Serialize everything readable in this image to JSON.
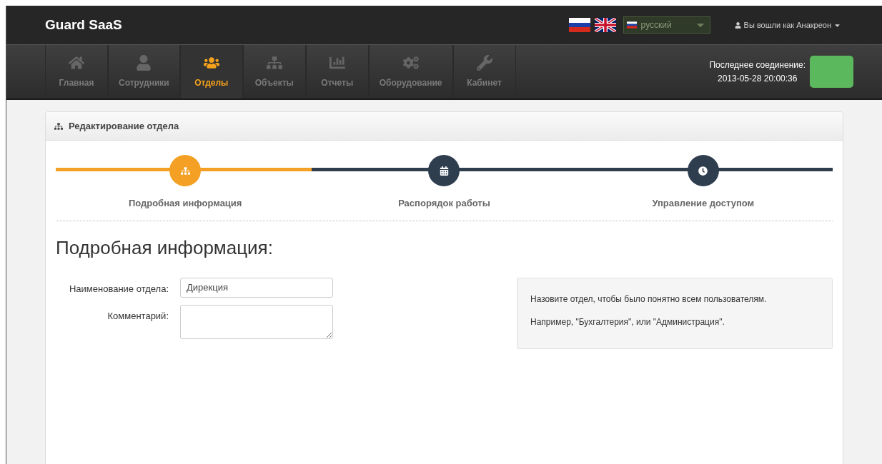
{
  "brand": "Guard SaaS",
  "language": {
    "value": "русский"
  },
  "user_menu": {
    "label": "Вы вошли как Анакреон"
  },
  "nav": [
    {
      "label": "Главная",
      "selected": false
    },
    {
      "label": "Сотрудники",
      "selected": false
    },
    {
      "label": "Отделы",
      "selected": true
    },
    {
      "label": "Объекты",
      "selected": false
    },
    {
      "label": "Отчеты",
      "selected": false
    },
    {
      "label": "Оборудование",
      "selected": false
    },
    {
      "label": "Кабинет",
      "selected": false
    }
  ],
  "connection": {
    "label": "Последнее соединение:",
    "time": "2013-05-28 20:00:36",
    "online": true
  },
  "panel_title": "Редактирование отдела",
  "steps": [
    {
      "label": "Подробная информация",
      "selected": true
    },
    {
      "label": "Распорядок работы",
      "selected": false
    },
    {
      "label": "Управление доступом",
      "selected": false
    }
  ],
  "section_title": "Подробная информация:",
  "form": [
    {
      "kind": "input",
      "label": "Наименование отдела:",
      "value": "Дирекция"
    },
    {
      "kind": "textarea",
      "label": "Комментарий:"
    }
  ],
  "help": [
    "Назовите отдел, чтобы было понятно всем пользователям.",
    "Например, \"Бухгалтерия\", или \"Администрация\"."
  ]
}
